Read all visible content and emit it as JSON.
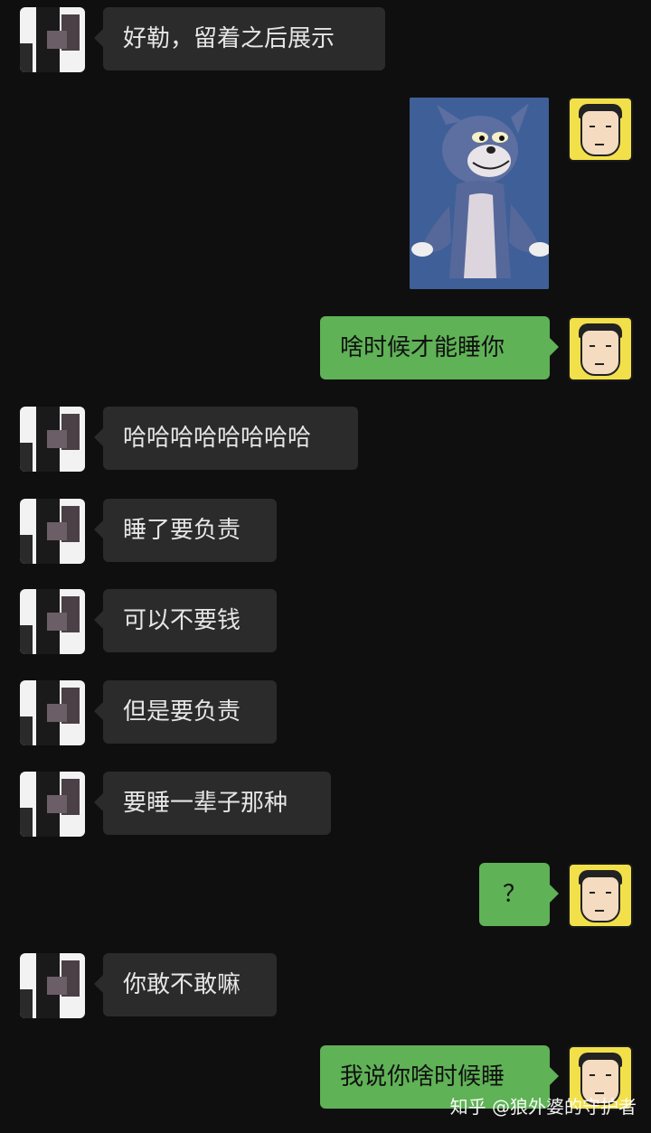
{
  "messages": [
    {
      "side": "left",
      "text": "好勒，留着之后展示"
    },
    {
      "side": "right",
      "type": "image",
      "icon": "tom-cat-sticker-image"
    },
    {
      "side": "right",
      "text": "啥时候才能睡你"
    },
    {
      "side": "left",
      "text": "哈哈哈哈哈哈哈哈"
    },
    {
      "side": "left",
      "text": "睡了要负责"
    },
    {
      "side": "left",
      "text": "可以不要钱"
    },
    {
      "side": "left",
      "text": "但是要负责"
    },
    {
      "side": "left",
      "text": "要睡一辈子那种"
    },
    {
      "side": "right",
      "text": "？"
    },
    {
      "side": "left",
      "text": "你敢不敢嘛"
    },
    {
      "side": "right",
      "text": "我说你啥时候睡"
    }
  ],
  "watermark": "知乎 @狼外婆的守护者",
  "colors": {
    "background": "#0f0f0f",
    "incoming_bubble": "#2b2b2b",
    "outgoing_bubble": "#5fb256"
  }
}
